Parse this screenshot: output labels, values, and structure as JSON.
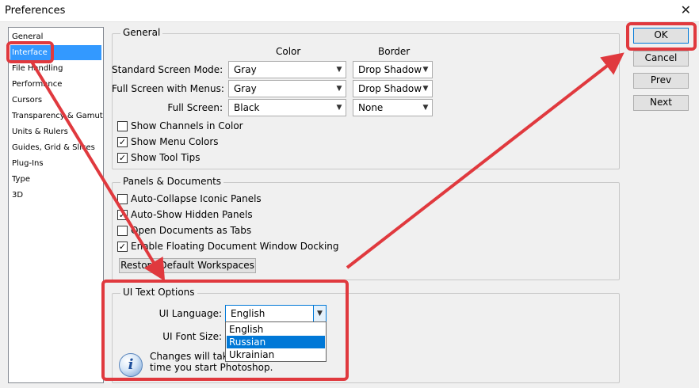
{
  "window": {
    "title": "Preferences",
    "close_glyph": "✕"
  },
  "sidebar": {
    "items": [
      {
        "label": "General"
      },
      {
        "label": "Interface"
      },
      {
        "label": "File Handling"
      },
      {
        "label": "Performance"
      },
      {
        "label": "Cursors"
      },
      {
        "label": "Transparency & Gamut"
      },
      {
        "label": "Units & Rulers"
      },
      {
        "label": "Guides, Grid & Slices"
      },
      {
        "label": "Plug-Ins"
      },
      {
        "label": "Type"
      },
      {
        "label": "3D"
      }
    ],
    "selected": "Interface"
  },
  "general": {
    "title": "General",
    "col_color": "Color",
    "col_border": "Border",
    "rows": [
      {
        "label": "Standard Screen Mode:",
        "color": "Gray",
        "border": "Drop Shadow"
      },
      {
        "label": "Full Screen with Menus:",
        "color": "Gray",
        "border": "Drop Shadow"
      },
      {
        "label": "Full Screen:",
        "color": "Black",
        "border": "None"
      }
    ],
    "checks": [
      {
        "label": "Show Channels in Color",
        "checked": false
      },
      {
        "label": "Show Menu Colors",
        "checked": true
      },
      {
        "label": "Show Tool Tips",
        "checked": true
      }
    ]
  },
  "panels": {
    "title": "Panels & Documents",
    "checks": [
      {
        "label": "Auto-Collapse Iconic Panels",
        "checked": false
      },
      {
        "label": "Auto-Show Hidden Panels",
        "checked": true
      },
      {
        "label": "Open Documents as Tabs",
        "checked": false
      },
      {
        "label": "Enable Floating Document Window Docking",
        "checked": true
      }
    ],
    "restore_button": "Restore Default Workspaces"
  },
  "ui_text": {
    "title": "UI Text Options",
    "language_label": "UI Language:",
    "language_value": "English",
    "font_size_label": "UI Font Size:",
    "language_options": [
      {
        "label": "English",
        "highlighted": false
      },
      {
        "label": "Russian",
        "highlighted": true
      },
      {
        "label": "Ukrainian",
        "highlighted": false
      }
    ],
    "note_line1": "Changes will take",
    "note_line2": "time you start Photoshop."
  },
  "buttons": {
    "ok": "OK",
    "cancel": "Cancel",
    "prev": "Prev",
    "next": "Next"
  },
  "icons": {
    "dropdown": "chevron-down-icon",
    "info": "info-icon",
    "check": "check-icon"
  },
  "colors": {
    "annotation": "#e0393e",
    "selection": "#3399ff",
    "focus": "#0078d7"
  }
}
